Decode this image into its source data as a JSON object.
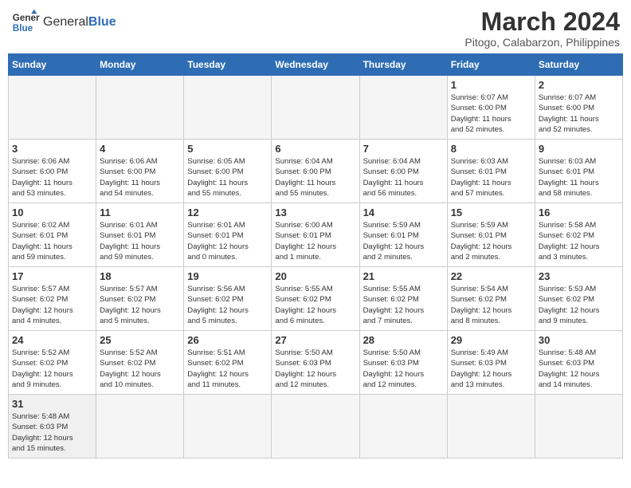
{
  "header": {
    "logo_general": "General",
    "logo_blue": "Blue",
    "title": "March 2024",
    "subtitle": "Pitogo, Calabarzon, Philippines"
  },
  "days_of_week": [
    "Sunday",
    "Monday",
    "Tuesday",
    "Wednesday",
    "Thursday",
    "Friday",
    "Saturday"
  ],
  "weeks": [
    [
      {
        "day": "",
        "info": ""
      },
      {
        "day": "",
        "info": ""
      },
      {
        "day": "",
        "info": ""
      },
      {
        "day": "",
        "info": ""
      },
      {
        "day": "",
        "info": ""
      },
      {
        "day": "1",
        "info": "Sunrise: 6:07 AM\nSunset: 6:00 PM\nDaylight: 11 hours\nand 52 minutes."
      },
      {
        "day": "2",
        "info": "Sunrise: 6:07 AM\nSunset: 6:00 PM\nDaylight: 11 hours\nand 52 minutes."
      }
    ],
    [
      {
        "day": "3",
        "info": "Sunrise: 6:06 AM\nSunset: 6:00 PM\nDaylight: 11 hours\nand 53 minutes."
      },
      {
        "day": "4",
        "info": "Sunrise: 6:06 AM\nSunset: 6:00 PM\nDaylight: 11 hours\nand 54 minutes."
      },
      {
        "day": "5",
        "info": "Sunrise: 6:05 AM\nSunset: 6:00 PM\nDaylight: 11 hours\nand 55 minutes."
      },
      {
        "day": "6",
        "info": "Sunrise: 6:04 AM\nSunset: 6:00 PM\nDaylight: 11 hours\nand 55 minutes."
      },
      {
        "day": "7",
        "info": "Sunrise: 6:04 AM\nSunset: 6:00 PM\nDaylight: 11 hours\nand 56 minutes."
      },
      {
        "day": "8",
        "info": "Sunrise: 6:03 AM\nSunset: 6:01 PM\nDaylight: 11 hours\nand 57 minutes."
      },
      {
        "day": "9",
        "info": "Sunrise: 6:03 AM\nSunset: 6:01 PM\nDaylight: 11 hours\nand 58 minutes."
      }
    ],
    [
      {
        "day": "10",
        "info": "Sunrise: 6:02 AM\nSunset: 6:01 PM\nDaylight: 11 hours\nand 59 minutes."
      },
      {
        "day": "11",
        "info": "Sunrise: 6:01 AM\nSunset: 6:01 PM\nDaylight: 11 hours\nand 59 minutes."
      },
      {
        "day": "12",
        "info": "Sunrise: 6:01 AM\nSunset: 6:01 PM\nDaylight: 12 hours\nand 0 minutes."
      },
      {
        "day": "13",
        "info": "Sunrise: 6:00 AM\nSunset: 6:01 PM\nDaylight: 12 hours\nand 1 minute."
      },
      {
        "day": "14",
        "info": "Sunrise: 5:59 AM\nSunset: 6:01 PM\nDaylight: 12 hours\nand 2 minutes."
      },
      {
        "day": "15",
        "info": "Sunrise: 5:59 AM\nSunset: 6:01 PM\nDaylight: 12 hours\nand 2 minutes."
      },
      {
        "day": "16",
        "info": "Sunrise: 5:58 AM\nSunset: 6:02 PM\nDaylight: 12 hours\nand 3 minutes."
      }
    ],
    [
      {
        "day": "17",
        "info": "Sunrise: 5:57 AM\nSunset: 6:02 PM\nDaylight: 12 hours\nand 4 minutes."
      },
      {
        "day": "18",
        "info": "Sunrise: 5:57 AM\nSunset: 6:02 PM\nDaylight: 12 hours\nand 5 minutes."
      },
      {
        "day": "19",
        "info": "Sunrise: 5:56 AM\nSunset: 6:02 PM\nDaylight: 12 hours\nand 5 minutes."
      },
      {
        "day": "20",
        "info": "Sunrise: 5:55 AM\nSunset: 6:02 PM\nDaylight: 12 hours\nand 6 minutes."
      },
      {
        "day": "21",
        "info": "Sunrise: 5:55 AM\nSunset: 6:02 PM\nDaylight: 12 hours\nand 7 minutes."
      },
      {
        "day": "22",
        "info": "Sunrise: 5:54 AM\nSunset: 6:02 PM\nDaylight: 12 hours\nand 8 minutes."
      },
      {
        "day": "23",
        "info": "Sunrise: 5:53 AM\nSunset: 6:02 PM\nDaylight: 12 hours\nand 9 minutes."
      }
    ],
    [
      {
        "day": "24",
        "info": "Sunrise: 5:52 AM\nSunset: 6:02 PM\nDaylight: 12 hours\nand 9 minutes."
      },
      {
        "day": "25",
        "info": "Sunrise: 5:52 AM\nSunset: 6:02 PM\nDaylight: 12 hours\nand 10 minutes."
      },
      {
        "day": "26",
        "info": "Sunrise: 5:51 AM\nSunset: 6:02 PM\nDaylight: 12 hours\nand 11 minutes."
      },
      {
        "day": "27",
        "info": "Sunrise: 5:50 AM\nSunset: 6:03 PM\nDaylight: 12 hours\nand 12 minutes."
      },
      {
        "day": "28",
        "info": "Sunrise: 5:50 AM\nSunset: 6:03 PM\nDaylight: 12 hours\nand 12 minutes."
      },
      {
        "day": "29",
        "info": "Sunrise: 5:49 AM\nSunset: 6:03 PM\nDaylight: 12 hours\nand 13 minutes."
      },
      {
        "day": "30",
        "info": "Sunrise: 5:48 AM\nSunset: 6:03 PM\nDaylight: 12 hours\nand 14 minutes."
      }
    ],
    [
      {
        "day": "31",
        "info": "Sunrise: 5:48 AM\nSunset: 6:03 PM\nDaylight: 12 hours\nand 15 minutes."
      },
      {
        "day": "",
        "info": ""
      },
      {
        "day": "",
        "info": ""
      },
      {
        "day": "",
        "info": ""
      },
      {
        "day": "",
        "info": ""
      },
      {
        "day": "",
        "info": ""
      },
      {
        "day": "",
        "info": ""
      }
    ]
  ]
}
